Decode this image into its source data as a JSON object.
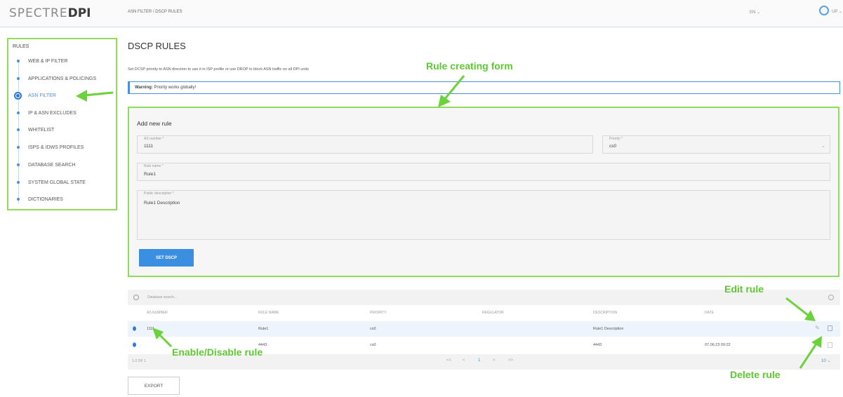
{
  "header": {
    "logo_light": "SPECTRE",
    "logo_bold": "DPI",
    "breadcrumb": "ASN FILTER / DSCP RULES",
    "language": "EN ⌄",
    "user": "UP ⌄"
  },
  "sidebar": {
    "title": "RULES",
    "items": [
      {
        "label": "WEB & IP FILTER"
      },
      {
        "label": "APPLICATIONS & POLICINGS"
      },
      {
        "label": "ASN FILTER"
      },
      {
        "label": "IP & ASN EXCLUDES"
      },
      {
        "label": "WHITELIST"
      },
      {
        "label": "ISPS & IDWS PROFILES"
      },
      {
        "label": "DATABASE SEARCH"
      },
      {
        "label": "SYSTEM GLOBAL STATE"
      },
      {
        "label": "DICTIONARIES"
      }
    ]
  },
  "main": {
    "title": "DSCP RULES",
    "subtitle": "Set DCSP priority to ASN direction to use it in ISP profile or use DROP to block ASN traffic on all DPI units",
    "warning_label": "Warning:",
    "warning_text": " Priority works globally!"
  },
  "form": {
    "title": "Add new rule",
    "as_number_label": "AS number *",
    "as_number_value": "1111",
    "priority_label": "Priority *",
    "priority_value": "cs0",
    "rule_name_label": "Rule name *",
    "rule_name_value": "Rule1",
    "description_label": "Public description *",
    "description_value": "Rule1 Description",
    "submit_label": "SET DSCP"
  },
  "table": {
    "search_placeholder": "Database search...",
    "columns": [
      "AS NUMBER",
      "RULE NAME",
      "PRIORITY",
      "REGULATOR",
      "DESCRIPTION",
      "DATE"
    ],
    "rows": [
      {
        "as_number": "1111",
        "rule_name": "Rule1",
        "priority": "cs0",
        "regulator": "",
        "description": "Rule1 Description",
        "date": ""
      },
      {
        "as_number": "",
        "rule_name": "4443",
        "priority": "cs0",
        "regulator": "",
        "description": "4443",
        "date": "07.06.23 09:22"
      }
    ],
    "range_text": "1-2 OF 1",
    "pagination": [
      "<<",
      "<",
      "1",
      ">",
      ">>"
    ],
    "page_size": "10 ⌄"
  },
  "export_label": "EXPORT",
  "annotations": {
    "form": "Rule creating form",
    "edit": "Edit rule",
    "toggle": "Enable/Disable rule",
    "delete": "Delete rule"
  },
  "colors": {
    "highlight": "#8fdc5a",
    "accent": "#3b8fe0"
  }
}
